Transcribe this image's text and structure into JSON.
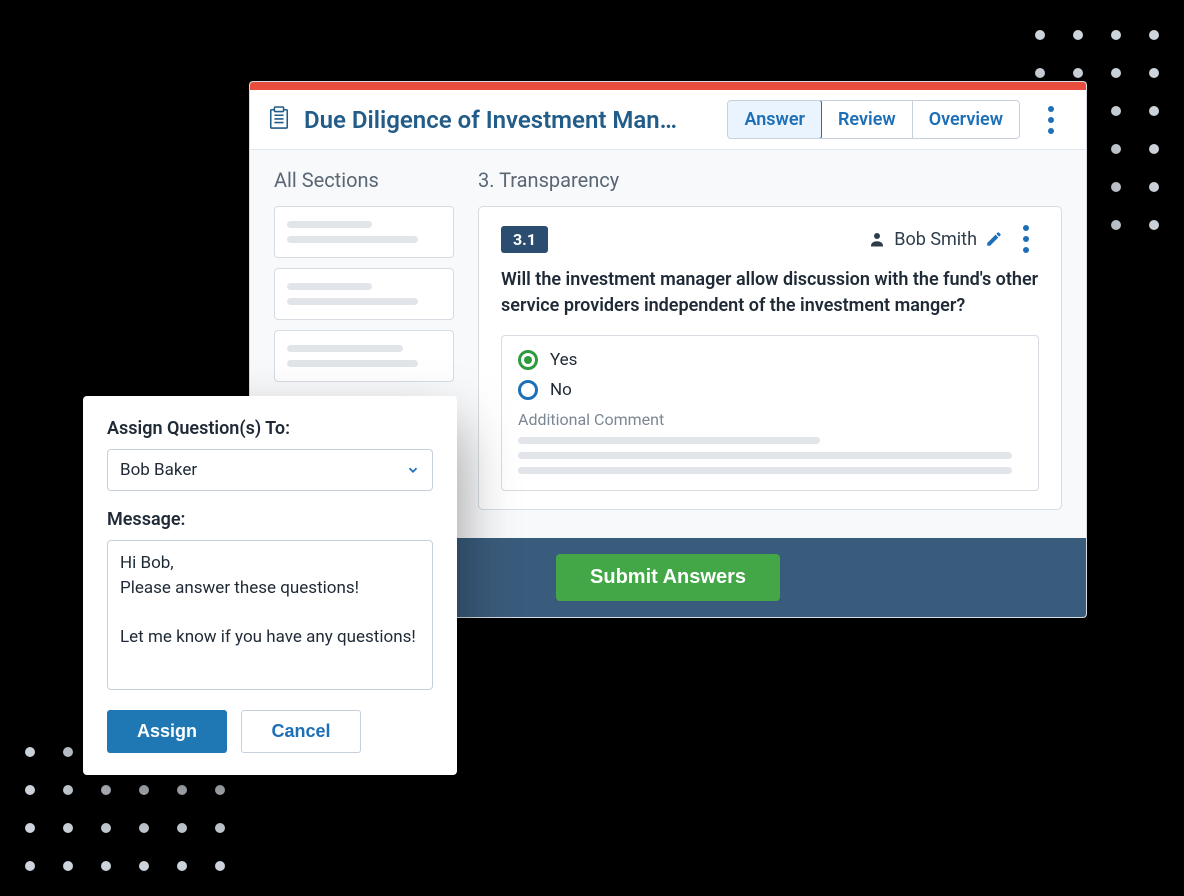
{
  "header": {
    "title": "Due Diligence of Investment Man…",
    "tabs": [
      "Answer",
      "Review",
      "Overview"
    ],
    "active_tab": "Answer"
  },
  "sidebar": {
    "title": "All Sections"
  },
  "section": {
    "title": "3. Transparency"
  },
  "question": {
    "number": "3.1",
    "assignee": "Bob Smith",
    "text": "Will the investment manager allow discussion with the fund's other service providers independent of the investment manger?",
    "options": {
      "yes": "Yes",
      "no": "No"
    },
    "selected": "yes",
    "additional_comment_label": "Additional Comment"
  },
  "footer": {
    "submit_label": "Submit Answers"
  },
  "modal": {
    "assign_label": "Assign Question(s) To:",
    "assignee_selected": "Bob Baker",
    "message_label": "Message:",
    "message_value": "Hi Bob,\nPlease answer these questions!\n\nLet me know if you have any questions!",
    "assign_btn": "Assign",
    "cancel_btn": "Cancel"
  }
}
